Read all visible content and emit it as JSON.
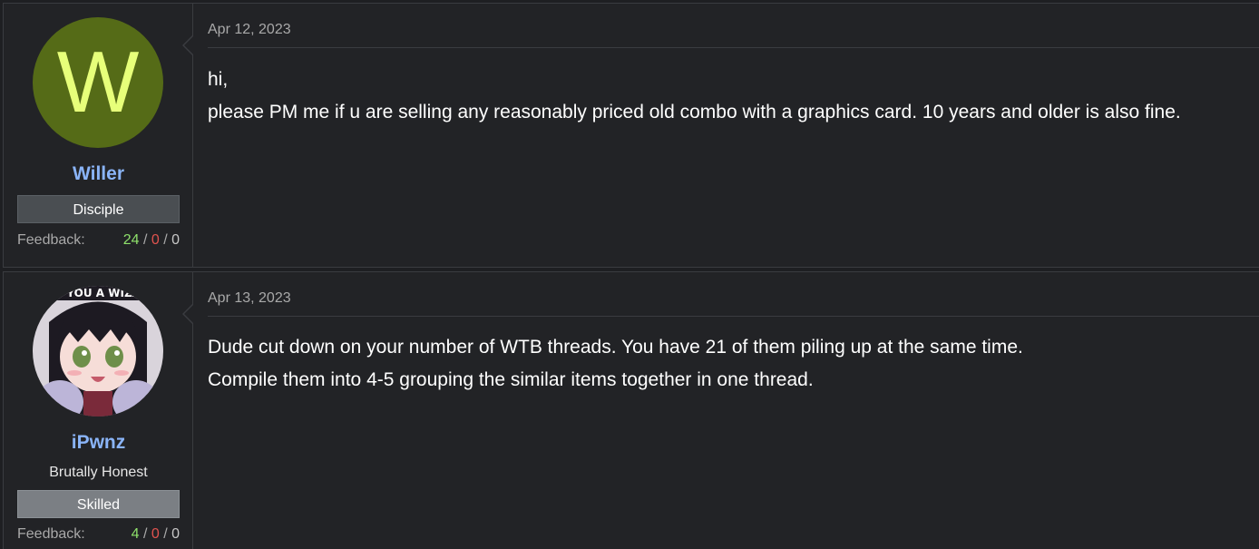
{
  "posts": [
    {
      "author": "Willer",
      "avatar_letter": "W",
      "avatar_color": "#556b17",
      "rank": "Disciple",
      "feedback_label": "Feedback:",
      "feedback": {
        "positive": "24",
        "negative": "0",
        "neutral": "0"
      },
      "date": "Apr 12, 2023",
      "body": [
        "hi,",
        "please PM me if u are selling any reasonably priced old combo with a graphics card. 10 years and older is also fine."
      ]
    },
    {
      "author": "iPwnz",
      "avatar_image_text": "E YOU A WIZA",
      "user_title": "Brutally Honest",
      "rank": "Skilled",
      "feedback_label": "Feedback:",
      "feedback": {
        "positive": "4",
        "negative": "0",
        "neutral": "0"
      },
      "date": "Apr 13, 2023",
      "body": [
        "Dude cut down on your number of WTB threads. You have 21 of them piling up at the same time.",
        "Compile them into 4-5 grouping the similar items together in one thread."
      ]
    }
  ],
  "colors": {
    "username": "#8ab4f8",
    "feedback_positive": "#8ee06b",
    "feedback_negative": "#e0534f"
  }
}
